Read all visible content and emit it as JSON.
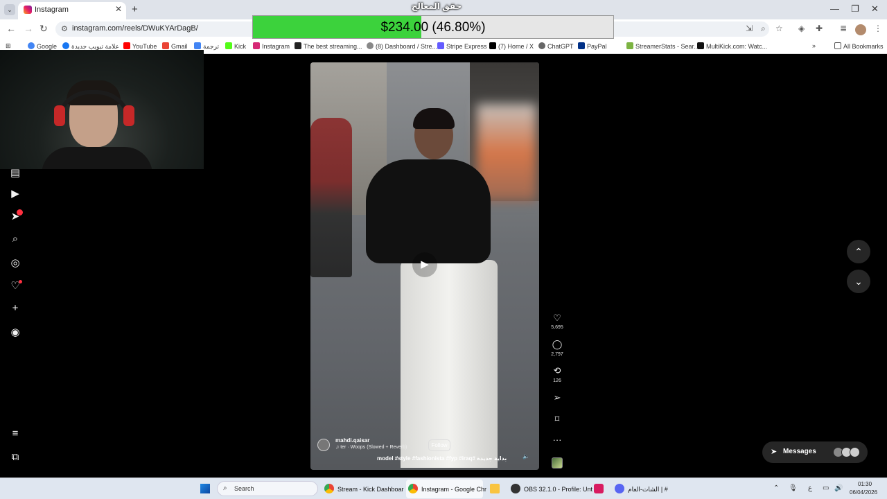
{
  "browser": {
    "tab_title": "Instagram",
    "url": "instagram.com/reels/DWuKYArDagB/",
    "bookmarks": [
      "Google",
      "علامة تبويب جديدة",
      "YouTube",
      "Gmail",
      "ترجمة",
      "Kick",
      "Instagram",
      "The best streaming...",
      "(8) Dashboard / Stre...",
      "Stripe Express",
      "(7) Home / X",
      "ChatGPT",
      "PayPal",
      "StreamerStats - Sear...",
      "MultiKick.com: Watc..."
    ],
    "all_bookmarks": "All Bookmarks"
  },
  "overlay": {
    "title": "حقق المعالج",
    "amount": "$234.00",
    "percent_text": "(46.80%)",
    "progress": 0.468,
    "fill_color": "#3cd23c"
  },
  "reel": {
    "username": "mahdi.qaisar",
    "audio": "ter · Woops (Slowed + Reverb)",
    "follow_label": "Follow",
    "caption": "model #style #fashionista #fyp #iraq# بداية جديدة",
    "likes": "5,695",
    "comments": "2,797",
    "reposts": "126"
  },
  "messages_label": "Messages",
  "taskbar": {
    "search_label": "Search",
    "apps": [
      "Stream - Kick Dashboar",
      "Instagram - Google Chr",
      "OBS 32.1.0 - Profile: Unt",
      "الشات-العام | #"
    ],
    "time": "01:30",
    "date": "06/04/2026",
    "lang": "ع"
  },
  "colors": {
    "badge": "#ff3040",
    "page_bg": "#000000"
  }
}
